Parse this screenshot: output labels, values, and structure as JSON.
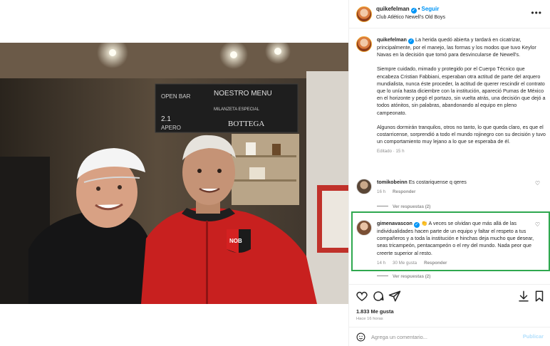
{
  "header": {
    "username": "quikefelman",
    "follow_label": "Seguir",
    "location": "Club Atlético Newell's Old Boys",
    "more_icon": "more-horizontal-icon"
  },
  "photo": {
    "wall_signs": [
      "OPEN BAR",
      "NOESTRO MENU",
      "MILANZETA ESPECIAL",
      "BOTTEGA",
      "2.1",
      "APERO"
    ],
    "jacket_badge": "NOB"
  },
  "caption": {
    "username": "quikefelman",
    "paragraphs": [
      "La herida quedó abierta y tardará en cicatrizar, principalmente, por el manejo, las formas y los modos que tuvo Keylor Navas en la decisión que tomó para desvincularse de Newell's.",
      "Siempre cuidado, mimado y protegido por el Cuerpo Técnico que encabeza Cristian Fabbiani, esperaban otra actitud de parte del arquero mundialista, nunca éste proceder, la actitud de querer rescindir el contrato que lo unía hasta diciembre con la institución, apareció Pumas de México en el horizonte y pegó el portazo, sin vuelta atrás, una decisión que dejó a todos atónitos, sin palabras, abandonando al equipo en pleno campeonato.",
      "Algunos dormirán tranquilos, otros no tanto, lo que queda claro, es que el costarricense, sorprendió a todo el mundo rojinegro con su decisión y tuvo un comportamiento muy lejano a lo que se esperaba de él."
    ],
    "meta": "Editado · 15 h"
  },
  "comments": [
    {
      "username": "tomikobeinn",
      "text": "Es costariquense q qeres",
      "time": "16 h",
      "likes": "",
      "reply_label": "Responder",
      "replies_label": "Ver respuestas (2)"
    },
    {
      "username": "gimenavascon",
      "emoji": "👏",
      "text": "A veces se olvidan que más allá de las individualidades hacen parte de un equipo y faltar el respeto a tus compañeros y a toda la institución e hinchas deja mucho que desear, seas tricampeón, pentacampeón o el rey del mundo. Nada peor que creerte superior al resto.",
      "time": "14 h",
      "likes": "30 Me gusta",
      "reply_label": "Responder",
      "replies_label": "Ver respuestas (2)"
    }
  ],
  "actions": {
    "likes_count": "1.833 Me gusta",
    "posted_ago": "Hace 16 horas",
    "icons": [
      "heart-icon",
      "comment-icon",
      "share-icon",
      "download-icon",
      "bookmark-icon"
    ]
  },
  "add_comment": {
    "placeholder": "Agrega un comentario...",
    "publish_label": "Publicar"
  },
  "colors": {
    "accent": "#0095f6",
    "highlight_box": "#2fa84f",
    "muted": "#8e8e8e",
    "publish_disabled": "#b2dffc"
  }
}
